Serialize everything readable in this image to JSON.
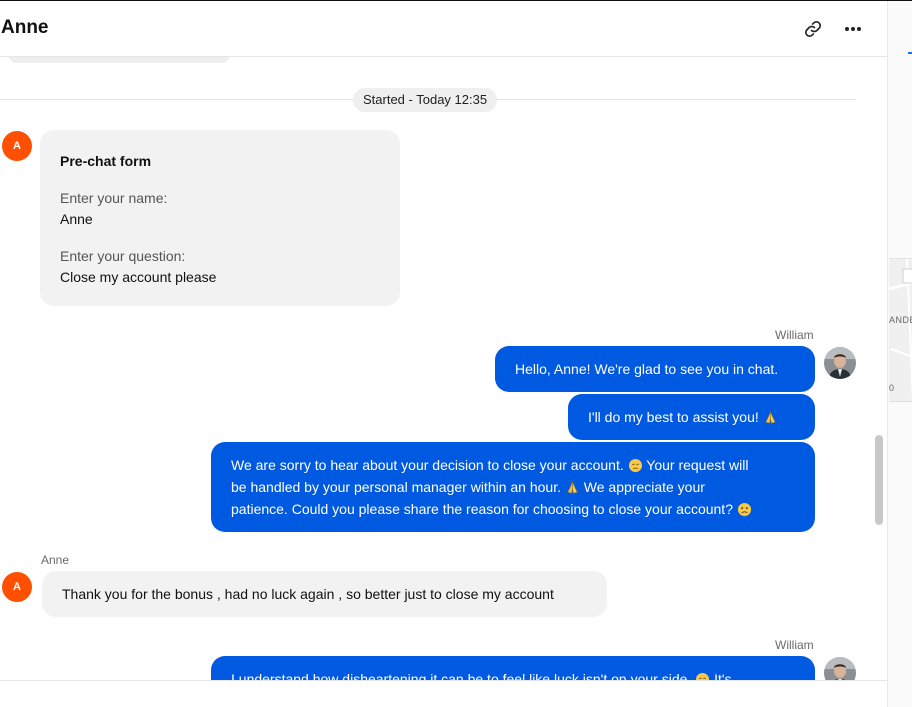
{
  "header": {
    "contact_name": "Anne",
    "icons": [
      "link-icon",
      "more-icon"
    ]
  },
  "system": {
    "started_label": "Started - Today 12:35"
  },
  "visitor": {
    "initial": "A",
    "name": "Anne"
  },
  "prechat_form": {
    "title": "Pre-chat form",
    "fields": [
      {
        "label": "Enter your name:",
        "value": "Anne"
      },
      {
        "label": "Enter your question:",
        "value": "Close my account please"
      }
    ]
  },
  "agent": {
    "name": "William"
  },
  "messages": [
    {
      "from": "agent",
      "text": "Hello, Anne! We're glad to see you in chat."
    },
    {
      "from": "agent",
      "text": "I'll do my best to assist you!",
      "emoji": "pray-emoji"
    },
    {
      "from": "agent",
      "line1a": "We are sorry to hear about your decision to close your account.",
      "line1b": "Your request will",
      "line2a": "be handled by your personal manager within an hour.",
      "line2b": "We appreciate your",
      "line3a": "patience. Could you please share the reason for choosing to close your account?",
      "emojis": [
        "disappointed-emoji",
        "pray-emoji",
        "slightly-frowning-emoji"
      ]
    },
    {
      "from": "visitor",
      "text": "Thank you for the bonus , had no luck again , so better just to close my account"
    },
    {
      "from": "agent",
      "text_partial_a": "I understand how disheartening it can be to feel like luck isn't on your side.",
      "text_partial_b": "It's"
    }
  ],
  "side_panel": {
    "map_text_1": "ANDE",
    "map_text_2": "0"
  },
  "colors": {
    "agent_bubble": "#0059e1",
    "visitor_bubble": "#f2f2f2",
    "avatar_orange": "#fe5000"
  }
}
